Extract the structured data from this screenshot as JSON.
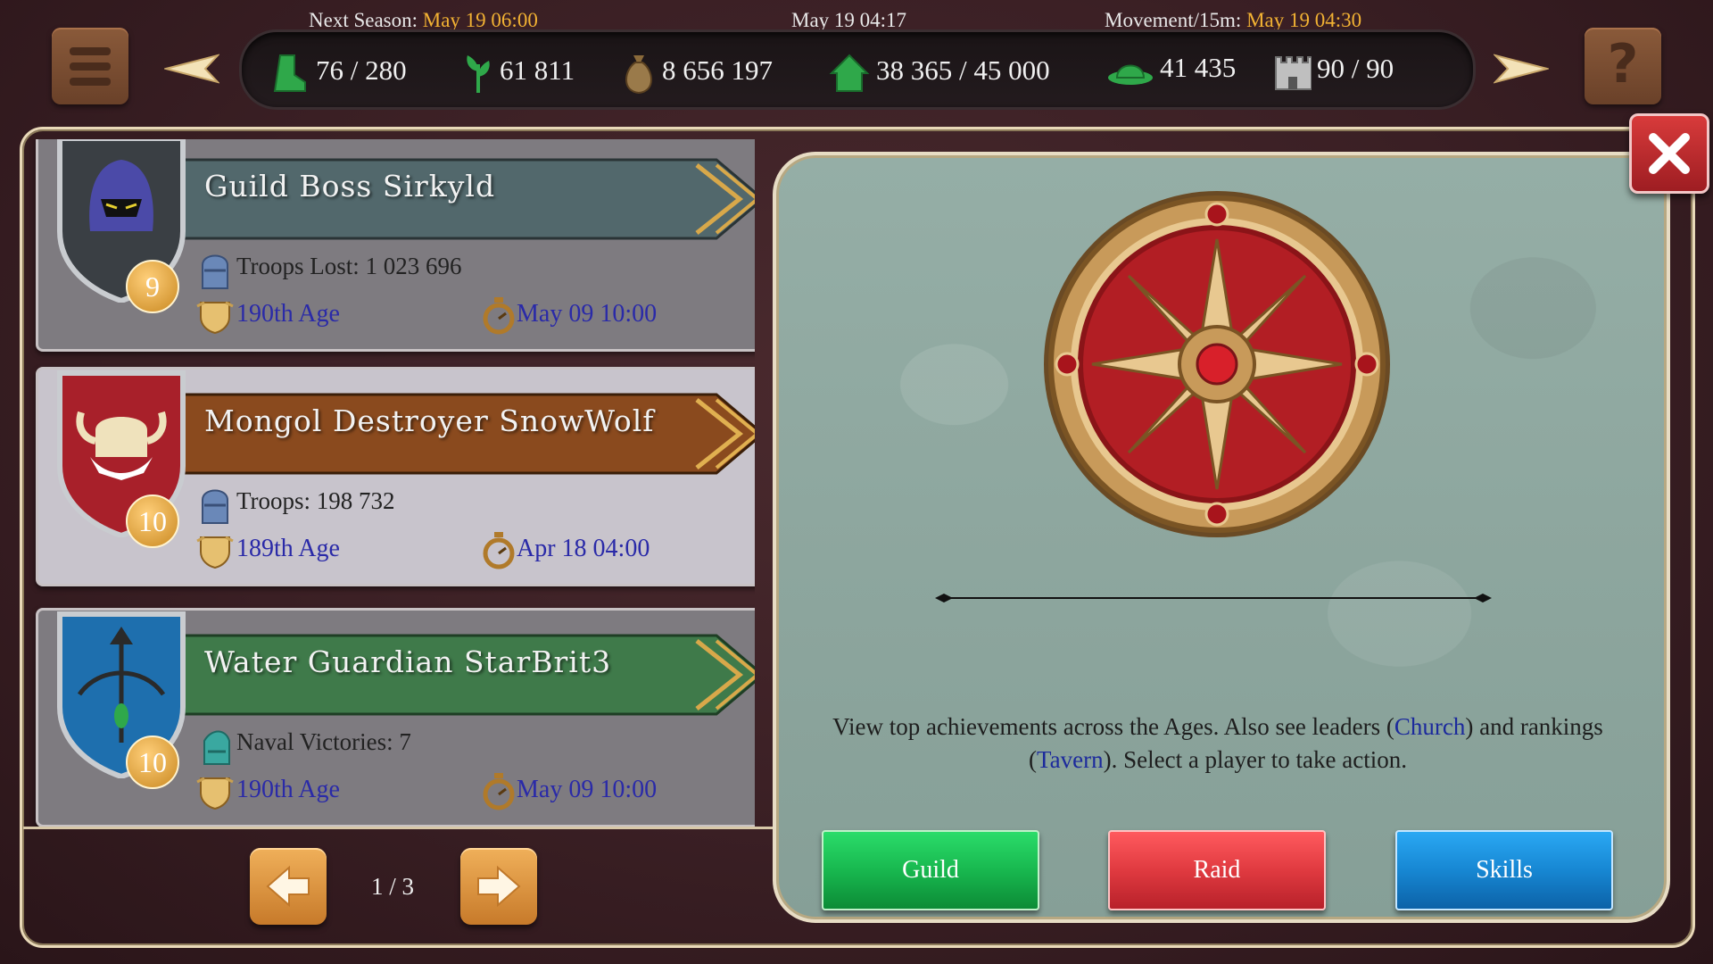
{
  "header": {
    "next_season_label": "Next Season:",
    "next_season_value": "May 19 06:00",
    "current_time": "May 19 04:17",
    "movement_label": "Movement/15m:",
    "movement_value": "May 19 04:30"
  },
  "resources": [
    {
      "icon": "boot-icon",
      "value": "76 / 280"
    },
    {
      "icon": "sprout-icon",
      "value": "61 811"
    },
    {
      "icon": "money-bag-icon",
      "value": "8 656 197"
    },
    {
      "icon": "house-icon",
      "value": "38 365 / 45 000"
    },
    {
      "icon": "hat-icon",
      "value": "41 435"
    },
    {
      "icon": "castle-icon",
      "value": "90 / 90"
    }
  ],
  "help_label": "?",
  "cards": [
    {
      "title": "Guild Boss Sirkyld",
      "level": "9",
      "stat": "Troops Lost: 1 023 696",
      "age": "190th Age",
      "date": "May 09 10:00",
      "banner_color": "#4e6468",
      "shield_icon": "hooded-figure-icon"
    },
    {
      "title": "Mongol Destroyer SnowWolf",
      "level": "10",
      "stat": "Troops: 198 732",
      "age": "189th Age",
      "date": "Apr 18 04:00",
      "banner_color": "#7a3f18",
      "shield_icon": "horned-helmet-icon"
    },
    {
      "title": "Water Guardian StarBrit3",
      "level": "10",
      "stat": "Naval Victories: 7",
      "age": "190th Age",
      "date": "May 09 10:00",
      "banner_color": "#3f7a48",
      "shield_icon": "crossbow-icon"
    }
  ],
  "pagination": {
    "text": "1 / 3"
  },
  "description": {
    "part1": "View top achievements across the Ages. Also see leaders (",
    "link1": "Church",
    "part2": ") and rankings (",
    "link2": "Tavern",
    "part3": "). Select a player to take action."
  },
  "buttons": {
    "guild": "Guild",
    "raid": "Raid",
    "skills": "Skills"
  },
  "colors": {
    "accent_yellow": "#f2b233",
    "link_blue": "#1c2a9c"
  }
}
